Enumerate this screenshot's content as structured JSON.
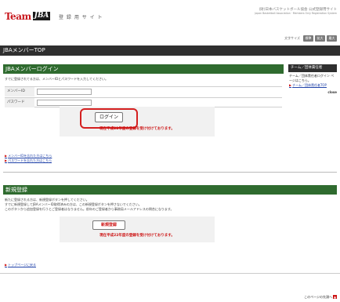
{
  "header": {
    "logo_team": "Team",
    "logo_jba": "JBA",
    "site_name": "登 録 用 サ イ ト",
    "org_name": "(財)日本バスケットボール協会 公式登録用サイト",
    "org_name_en": "Japan Basketball Association · Members Only Registration System"
  },
  "font_size": {
    "label": "文字サイズ",
    "buttons": [
      "標準",
      "拡大",
      "最大"
    ]
  },
  "page_title": "JBAメンバーTOP",
  "login": {
    "section_title": "JBAメンバーログイン",
    "intro": "すでに登録されてる方は、メンバーIDとパスワードを入力してください。",
    "id_label": "メンバーID",
    "id_value": "",
    "password_label": "パスワード",
    "password_value": "",
    "button_label": "ログイン",
    "notice": "現在平成22年度の登録を受け付けております。"
  },
  "help_links": {
    "arrow": "▶",
    "forgot_id": "メンバーIDを忘れた方はこちら",
    "forgot_password": "パスワードを忘れた方はこちら"
  },
  "sidebar": {
    "title": "チーム／団体責任者",
    "text": "チーム／団体責任者ログイン ページはこちら。",
    "link_arrow": "▶",
    "link": "チーム／団体責任者TOP",
    "close": "close"
  },
  "register": {
    "section_title": "新規登録",
    "lines": [
      "新たに登録される方は、新規登録ボタンを押してください。",
      "すでに新規登録してJBAメンバーID取得済みの方は、この新規登録ボタンを押さないでください。",
      "このボタンから追加登録を行うとご登録者はなりません。前年のご登録者から事務局メールアドレスの問合になります。"
    ],
    "button_label": "新規登録",
    "notice": "現在平成22年度の登録を受け付けております。"
  },
  "footer": {
    "top_link_arrow": "▶",
    "top_link": "トップページに戻る",
    "page_top": "このページの先頭へ",
    "page_top_icon": "▲"
  },
  "colors": {
    "accent_red": "#cc1111",
    "section_green": "#2f6b2f",
    "title_bar": "#2f2f2f",
    "link_blue": "#2244aa"
  }
}
